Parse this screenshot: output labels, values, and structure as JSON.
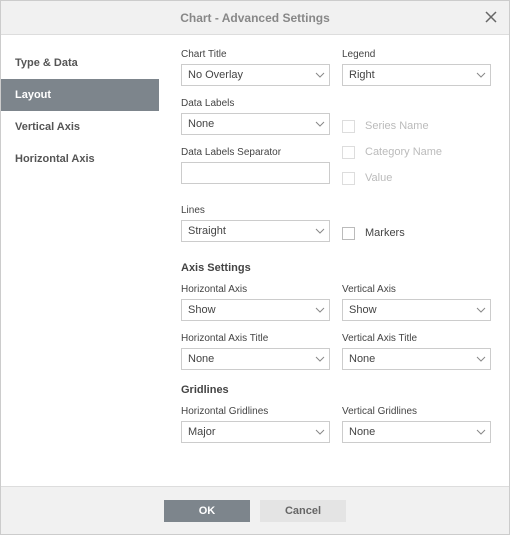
{
  "dialog": {
    "title": "Chart - Advanced Settings"
  },
  "sidebar": {
    "items": [
      {
        "label": "Type & Data"
      },
      {
        "label": "Layout"
      },
      {
        "label": "Vertical Axis"
      },
      {
        "label": "Horizontal Axis"
      }
    ]
  },
  "layout": {
    "chart_title_label": "Chart Title",
    "chart_title_value": "No Overlay",
    "legend_label": "Legend",
    "legend_value": "Right",
    "data_labels_label": "Data Labels",
    "data_labels_value": "None",
    "series_name_label": "Series Name",
    "category_name_label": "Category Name",
    "value_label": "Value",
    "separator_label": "Data Labels Separator",
    "separator_value": "",
    "lines_label": "Lines",
    "lines_value": "Straight",
    "markers_label": "Markers",
    "axis_settings_heading": "Axis Settings",
    "h_axis_label": "Horizontal Axis",
    "h_axis_value": "Show",
    "v_axis_label": "Vertical Axis",
    "v_axis_value": "Show",
    "h_axis_title_label": "Horizontal Axis Title",
    "h_axis_title_value": "None",
    "v_axis_title_label": "Vertical Axis Title",
    "v_axis_title_value": "None",
    "gridlines_heading": "Gridlines",
    "h_grid_label": "Horizontal Gridlines",
    "h_grid_value": "Major",
    "v_grid_label": "Vertical Gridlines",
    "v_grid_value": "None"
  },
  "footer": {
    "ok": "OK",
    "cancel": "Cancel"
  }
}
